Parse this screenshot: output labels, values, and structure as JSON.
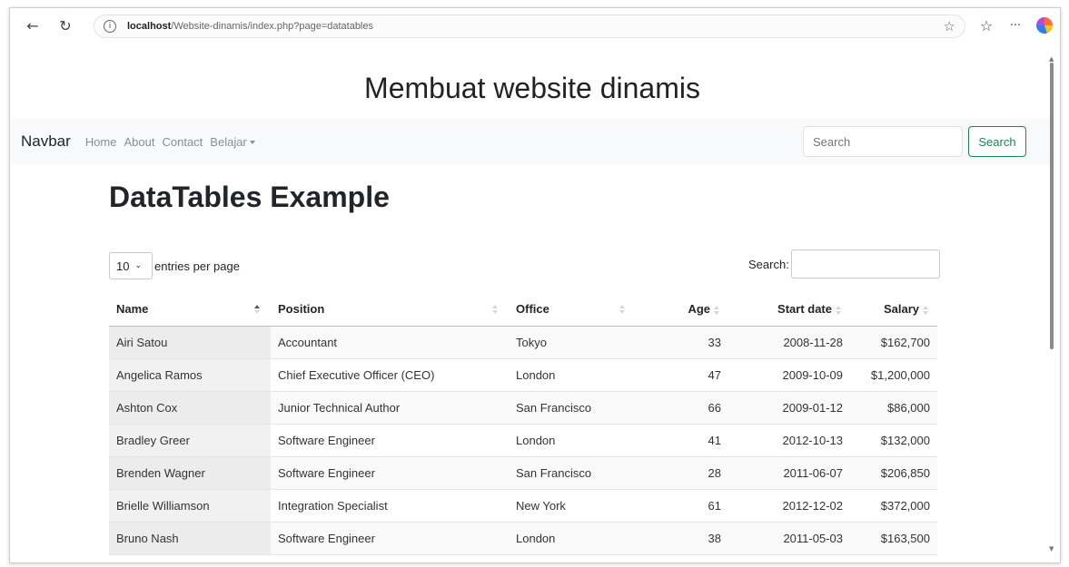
{
  "browser": {
    "url_host": "localhost",
    "url_path": "/Website-dinamis/index.php?page=datatables",
    "icons": [
      "back-arrow-icon",
      "reload-icon",
      "info-icon",
      "star-icon",
      "favorites-icon",
      "more-icon",
      "copilot-icon"
    ]
  },
  "site": {
    "title": "Membuat website dinamis"
  },
  "navbar": {
    "brand": "Navbar",
    "links": [
      "Home",
      "About",
      "Contact",
      "Belajar"
    ],
    "search_placeholder": "Search",
    "search_button": "Search",
    "button_color": "#198754"
  },
  "datatable": {
    "title": "DataTables Example",
    "length_value": "10",
    "length_label": "entries per page",
    "search_label": "Search:",
    "columns": [
      "Name",
      "Position",
      "Office",
      "Age",
      "Start date",
      "Salary"
    ],
    "rows": [
      [
        "Airi Satou",
        "Accountant",
        "Tokyo",
        "33",
        "2008-11-28",
        "$162,700"
      ],
      [
        "Angelica Ramos",
        "Chief Executive Officer (CEO)",
        "London",
        "47",
        "2009-10-09",
        "$1,200,000"
      ],
      [
        "Ashton Cox",
        "Junior Technical Author",
        "San Francisco",
        "66",
        "2009-01-12",
        "$86,000"
      ],
      [
        "Bradley Greer",
        "Software Engineer",
        "London",
        "41",
        "2012-10-13",
        "$132,000"
      ],
      [
        "Brenden Wagner",
        "Software Engineer",
        "San Francisco",
        "28",
        "2011-06-07",
        "$206,850"
      ],
      [
        "Brielle Williamson",
        "Integration Specialist",
        "New York",
        "61",
        "2012-12-02",
        "$372,000"
      ],
      [
        "Bruno Nash",
        "Software Engineer",
        "London",
        "38",
        "2011-05-03",
        "$163,500"
      ]
    ]
  }
}
